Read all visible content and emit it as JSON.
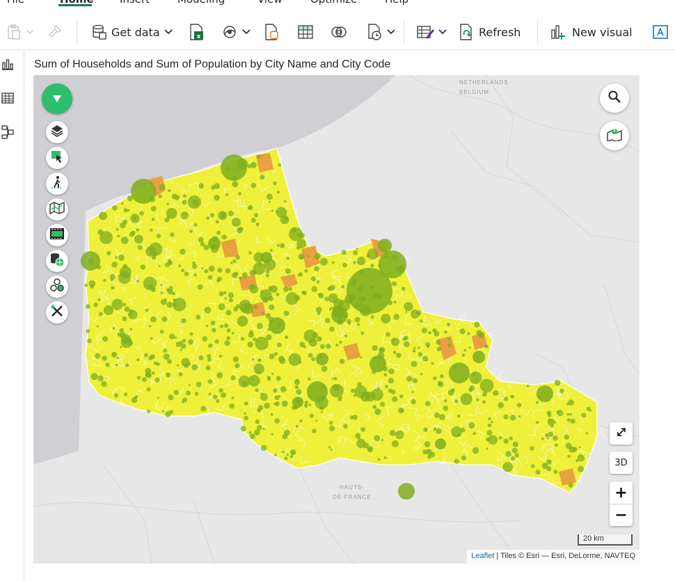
{
  "ribbon": {
    "tabs": [
      "File",
      "Home",
      "Insert",
      "Modeling",
      "View",
      "Optimize",
      "Help"
    ],
    "active_tab": "Home",
    "accent_color": "#117865"
  },
  "toolbar": {
    "get_data_label": "Get data",
    "refresh_label": "Refresh",
    "new_visual_label": "New visual",
    "icons": [
      "paste-icon",
      "format-painter-icon",
      "database-icon",
      "excel-icon",
      "onelake-icon",
      "sql-icon",
      "enter-data-icon",
      "dataverse-icon",
      "recent-sources-icon",
      "transform-data-icon",
      "refresh-icon",
      "new-visual-icon",
      "text-box-icon"
    ]
  },
  "left_rail": {
    "items": [
      "report-view-icon",
      "table-view-icon",
      "model-view-icon"
    ]
  },
  "visual": {
    "title": "Sum of Households and Sum of Population by City Name and City Code"
  },
  "map": {
    "labels": {
      "netherlands": "NETHERLANDS",
      "belgium": "BELGIUM",
      "region_line1": "HAUTS-",
      "region_line2": "DE-FRANCE"
    },
    "controls": {
      "three_d": "3D",
      "zoom_in": "+",
      "zoom_out": "−"
    },
    "scale_label": "20 km",
    "attribution_link": "Leaflet",
    "attribution_text": " | Tiles © Esri — Esri, DeLorme, NAVTEQ",
    "colors": {
      "region_fill": "#eef03a",
      "hotspot_fill": "#e8a040",
      "bubble_fill": "#7fae1e",
      "sea": "#cfcfd4",
      "land": "#e7e7e7",
      "button_green": "#2ebd6b"
    },
    "left_tools": [
      "layers-icon",
      "select-icon",
      "walk-icon",
      "map-icon",
      "film-icon",
      "data-globe-icon",
      "hexbin-icon",
      "tools-icon"
    ]
  }
}
